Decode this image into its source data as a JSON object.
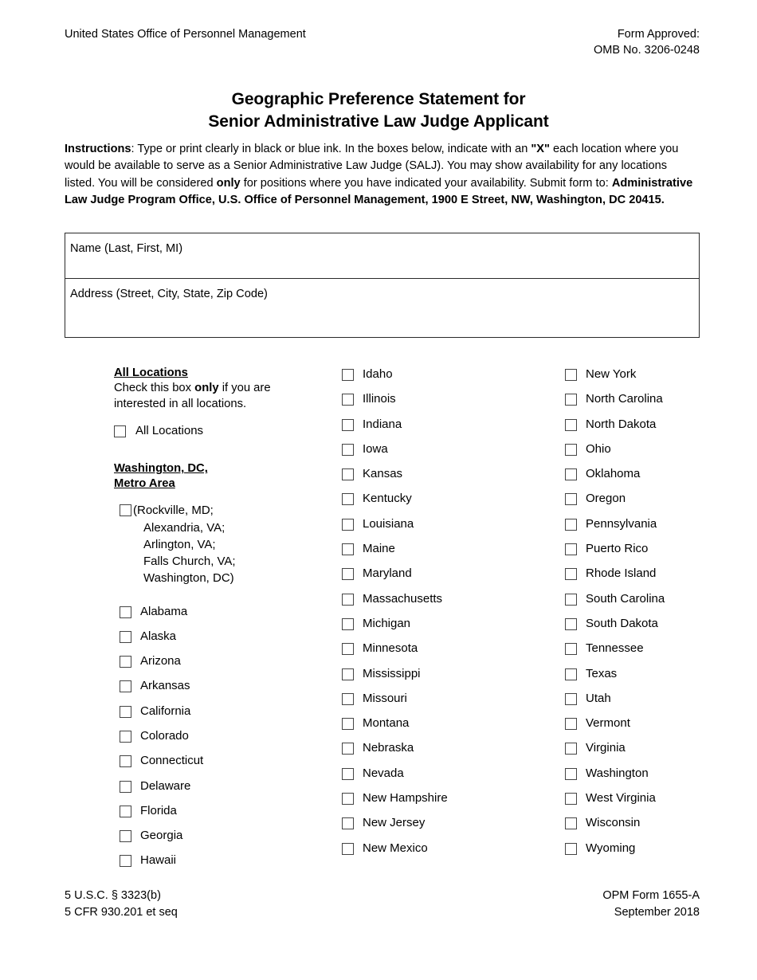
{
  "header": {
    "agency": "United States Office of Personnel Management",
    "form_approved": "Form Approved:",
    "omb_number": "OMB No. 3206-0248"
  },
  "title": {
    "line1": "Geographic Preference Statement for",
    "line2": "Senior Administrative Law Judge Applicant"
  },
  "instructions": {
    "label": "Instructions",
    "text_1": ": Type or print clearly in black or blue ink. In the boxes below, indicate with an ",
    "x_mark": "\"X\"",
    "text_2": " each location where you would be available to serve as a Senior Administrative Law Judge (SALJ). You may show availability for any locations listed. You will be considered ",
    "only": "only",
    "text_3": " for positions where you have indicated your availability. Submit form to: ",
    "office_address": "Administrative Law Judge Program Office, U.S. Office of Personnel Management, 1900 E Street, NW, Washington, DC 20415."
  },
  "fields": {
    "name_label": "Name (Last, First, MI)",
    "name_value": "",
    "address_label": "Address (Street, City, State, Zip Code)",
    "address_value": ""
  },
  "all_locations": {
    "heading": "All Locations",
    "blurb_pre": "Check this box ",
    "blurb_bold": "only",
    "blurb_post": " if you are interested in all locations.",
    "checkbox_label": "All Locations"
  },
  "metro": {
    "heading_line1": "Washington, DC,",
    "heading_line2": "Metro Area",
    "lines": [
      "(Rockville, MD;",
      "Alexandria, VA;",
      "Arlington, VA;",
      "Falls Church, VA;",
      "Washington, DC)"
    ]
  },
  "columns": [
    {
      "name": "column-1",
      "locations": [
        "Alabama",
        "Alaska",
        "Arizona",
        "Arkansas",
        "California",
        "Colorado",
        "Connecticut",
        "Delaware",
        "Florida",
        "Georgia",
        "Hawaii"
      ]
    },
    {
      "name": "column-2",
      "locations": [
        "Idaho",
        "Illinois",
        "Indiana",
        "Iowa",
        "Kansas",
        "Kentucky",
        "Louisiana",
        "Maine",
        "Maryland",
        "Massachusetts",
        "Michigan",
        "Minnesota",
        "Mississippi",
        "Missouri",
        "Montana",
        "Nebraska",
        "Nevada",
        "New Hampshire",
        "New Jersey",
        "New Mexico"
      ]
    },
    {
      "name": "column-3",
      "locations": [
        "New York",
        "North Carolina",
        "North Dakota",
        "Ohio",
        "Oklahoma",
        "Oregon",
        "Pennsylvania",
        "Puerto Rico",
        "Rhode Island",
        "South Carolina",
        "South Dakota",
        "Tennessee",
        "Texas",
        "Utah",
        "Vermont",
        "Virginia",
        "Washington",
        "West Virginia",
        "Wisconsin",
        "Wyoming"
      ]
    }
  ],
  "footer": {
    "left_line1": "5 U.S.C. § 3323(b)",
    "left_line2": "5 CFR 930.201 et seq",
    "right_line1": "OPM Form 1655-A",
    "right_line2": "September 2018"
  }
}
